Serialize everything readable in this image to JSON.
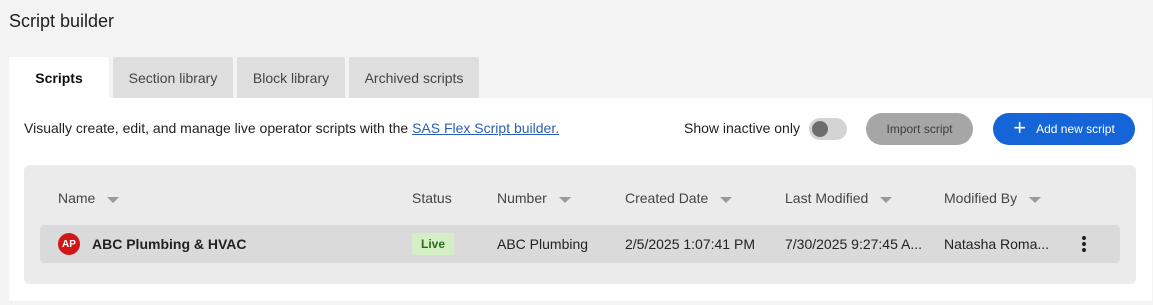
{
  "page": {
    "title": "Script builder"
  },
  "tabs": [
    {
      "label": "Scripts",
      "active": true
    },
    {
      "label": "Section library",
      "active": false
    },
    {
      "label": "Block library",
      "active": false
    },
    {
      "label": "Archived scripts",
      "active": false
    }
  ],
  "intro": {
    "text": "Visually create, edit, and manage live operator scripts with the ",
    "link": "SAS Flex Script builder."
  },
  "controls": {
    "show_inactive_label": "Show inactive only",
    "show_inactive_on": false,
    "import_label": "Import script",
    "add_label": "Add new script",
    "add_icon": "plus-icon"
  },
  "table": {
    "columns": [
      "Name",
      "Status",
      "Number",
      "Created Date",
      "Last Modified",
      "Modified By"
    ],
    "rows": [
      {
        "initials": "AP",
        "name": "ABC Plumbing & HVAC",
        "status": "Live",
        "number": "ABC Plumbing",
        "created": "2/5/2025 1:07:41 PM",
        "modified": "7/30/2025 9:27:45 A...",
        "modified_by": "Natasha Roma..."
      }
    ]
  },
  "colors": {
    "accent": "#1565d8",
    "avatar": "#cf1717",
    "live_badge_bg": "#d4efc6",
    "live_badge_fg": "#2e6a1d"
  }
}
